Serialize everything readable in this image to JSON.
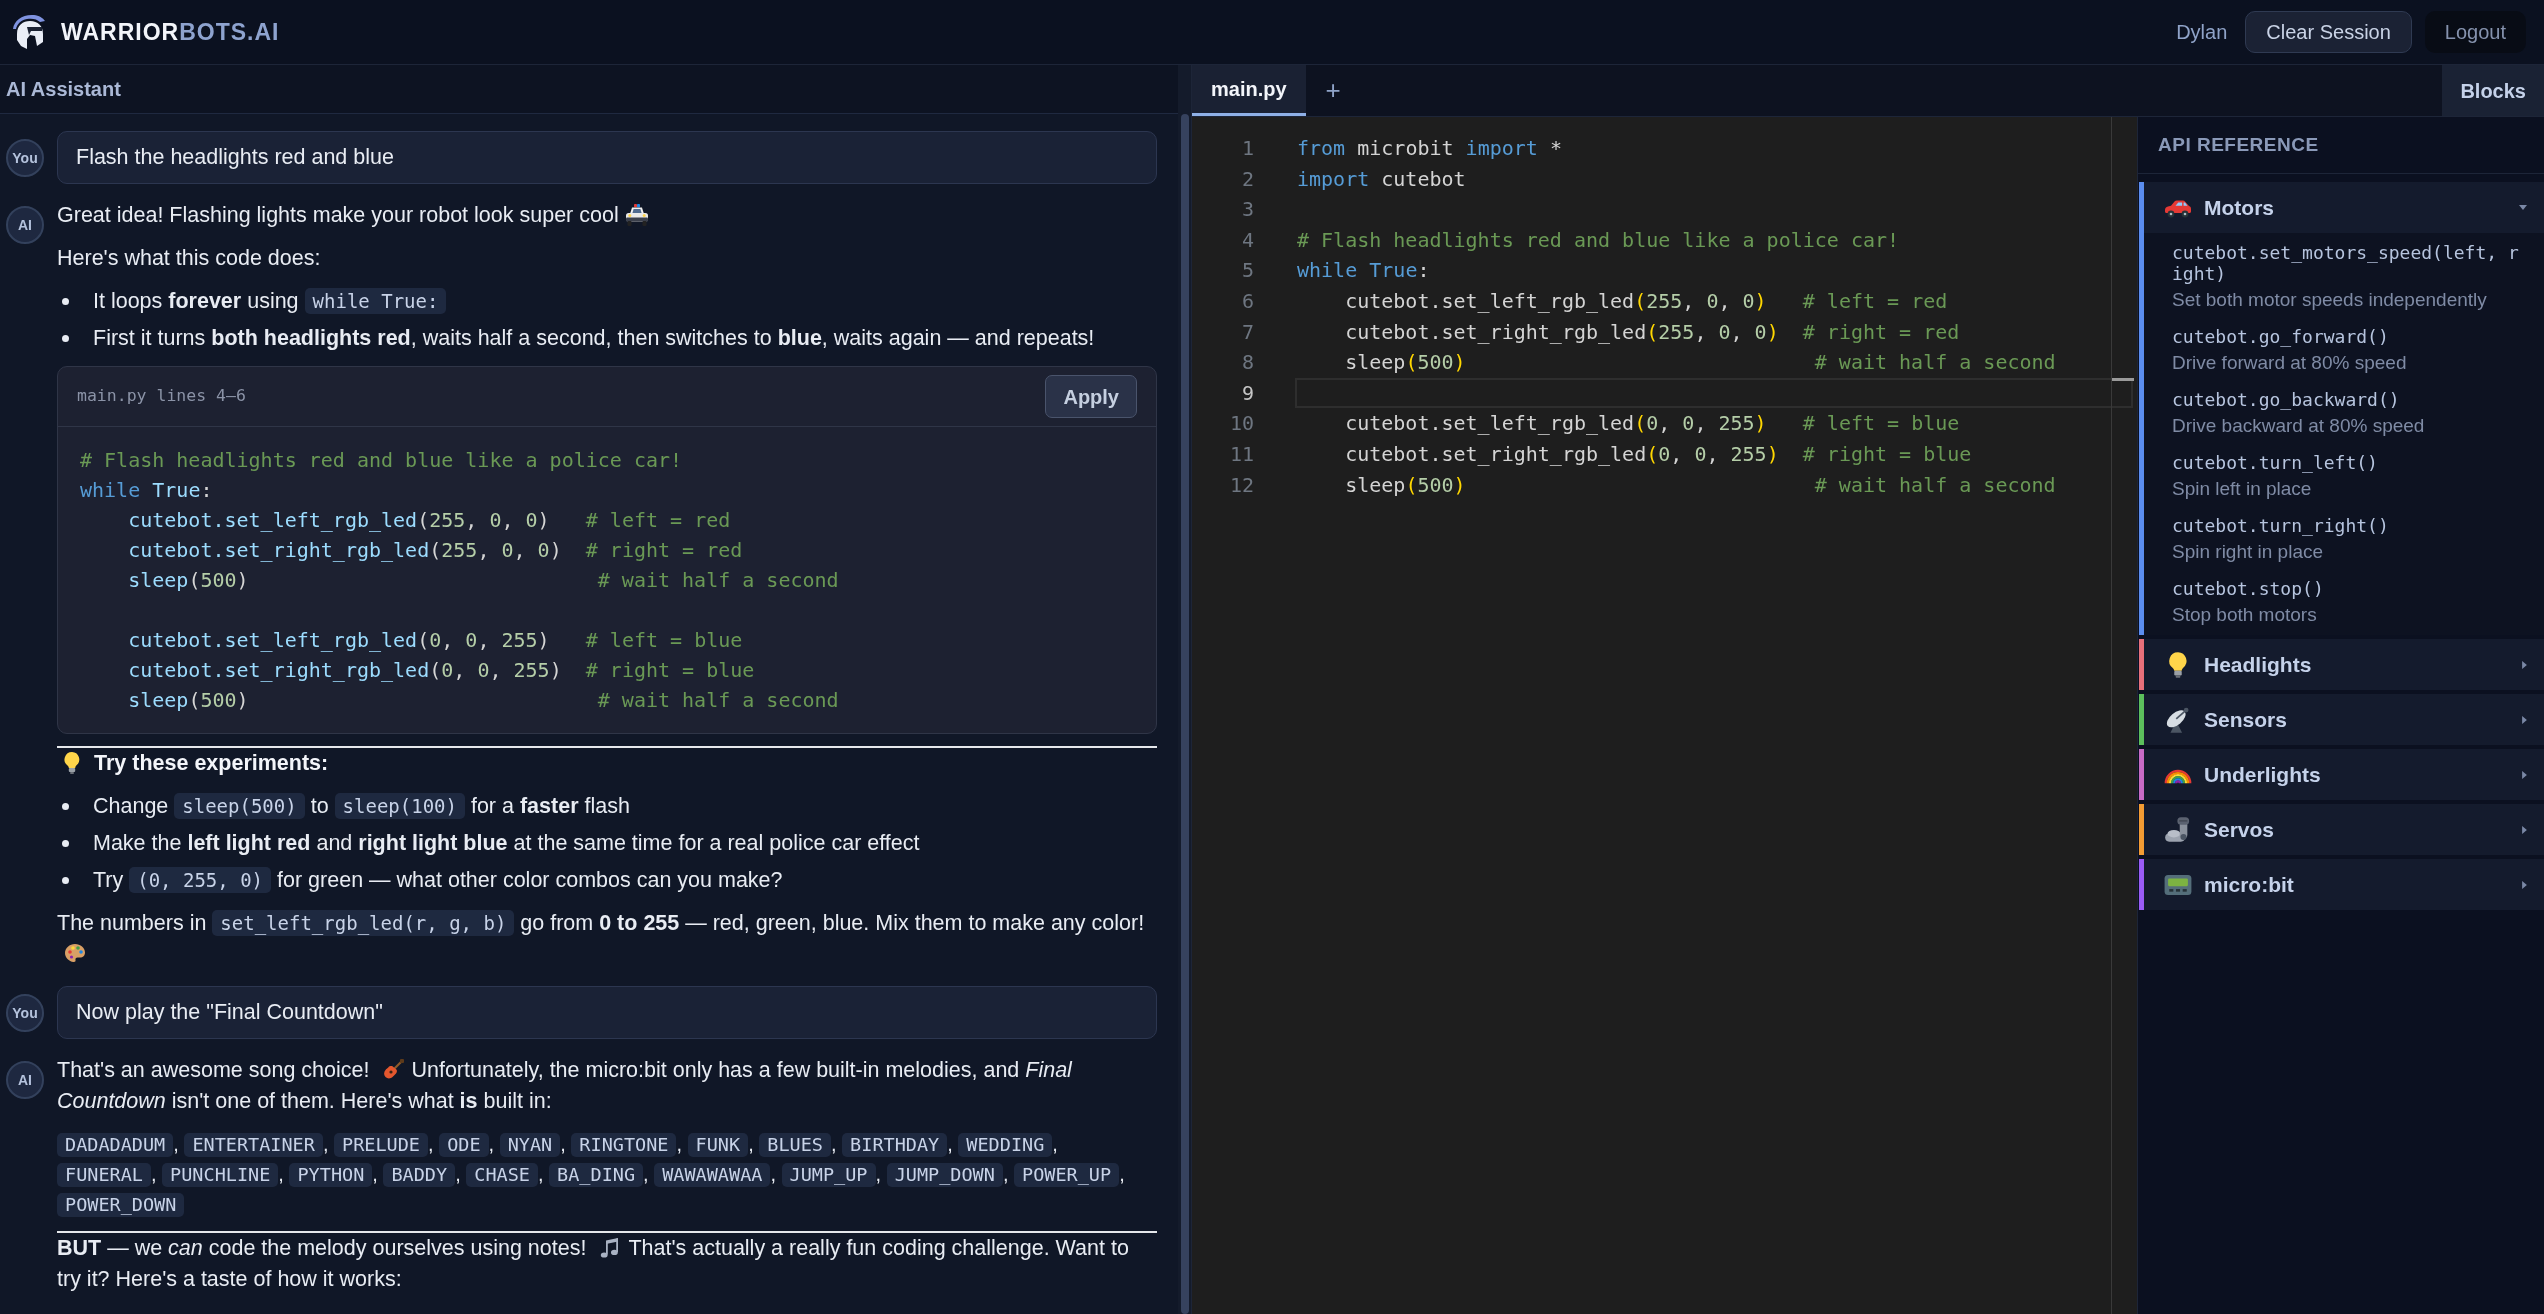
{
  "header": {
    "brand": {
      "primary": "WARRIOR",
      "secondary": "BOTS.AI"
    },
    "user": "Dylan",
    "buttons": [
      {
        "label": "Clear Session",
        "kind": "outlined"
      },
      {
        "label": "Logout",
        "kind": "plain"
      }
    ]
  },
  "chat": {
    "title": "AI Assistant",
    "messages": [
      {
        "kind": "user",
        "avatar": "You",
        "text": "Flash the headlights red and blue"
      },
      {
        "kind": "assistant",
        "avatar": "AI",
        "blocks": [
          {
            "kind": "paragraph",
            "segments": [
              {
                "kind": "text",
                "text": "Great idea! Flashing lights make your robot look super cool"
              },
              {
                "kind": "emoji"
              }
            ]
          },
          {
            "kind": "paragraph",
            "segments": [
              {
                "kind": "text",
                "text": "Here's what this code does:"
              }
            ]
          },
          {
            "kind": "bullets",
            "items": [
              [
                {
                  "kind": "text",
                  "text": "It loops **forever** using "
                },
                {
                  "kind": "code",
                  "text": "while True:"
                }
              ],
              [
                {
                  "kind": "text",
                  "text": "First it turns **both headlights red**, waits half a second, then switches to **blue**, waits again — and repeats!"
                }
              ]
            ]
          },
          {
            "kind": "code",
            "title": "main.py lines 4–6",
            "button": "Apply",
            "lines": [
              {
                "kind": "code",
                "tokens": [
                  {
                    "kind": "comment",
                    "text": "# Flash headlights red and blue like a police car!"
                  }
                ]
              },
              {
                "kind": "code",
                "tokens": [
                  {
                    "kind": "keyword",
                    "text": "while"
                  },
                  {
                    "kind": "name",
                    "text": " True"
                  },
                  {
                    "kind": "plain",
                    "text": ":"
                  }
                ]
              },
              {
                "kind": "code",
                "tokens": [
                  {
                    "kind": "name",
                    "text": "    cutebot.set_left_rgb_led"
                  },
                  {
                    "kind": "plain",
                    "text": "("
                  },
                  {
                    "kind": "number",
                    "text": "255"
                  },
                  {
                    "kind": "plain",
                    "text": ", "
                  },
                  {
                    "kind": "number",
                    "text": "0"
                  },
                  {
                    "kind": "plain",
                    "text": ", "
                  },
                  {
                    "kind": "number",
                    "text": "0"
                  },
                  {
                    "kind": "plain",
                    "text": ")"
                  },
                  {
                    "kind": "comment",
                    "text": "   # left = red"
                  }
                ]
              },
              {
                "kind": "code",
                "tokens": [
                  {
                    "kind": "name",
                    "text": "    cutebot.set_right_rgb_led"
                  },
                  {
                    "kind": "plain",
                    "text": "("
                  },
                  {
                    "kind": "number",
                    "text": "255"
                  },
                  {
                    "kind": "plain",
                    "text": ", "
                  },
                  {
                    "kind": "number",
                    "text": "0"
                  },
                  {
                    "kind": "plain",
                    "text": ", "
                  },
                  {
                    "kind": "number",
                    "text": "0"
                  },
                  {
                    "kind": "plain",
                    "text": ")"
                  },
                  {
                    "kind": "comment",
                    "text": "  # right = red"
                  }
                ]
              },
              {
                "kind": "code",
                "tokens": [
                  {
                    "kind": "name",
                    "text": "    sleep"
                  },
                  {
                    "kind": "plain",
                    "text": "("
                  },
                  {
                    "kind": "number",
                    "text": "500"
                  },
                  {
                    "kind": "plain",
                    "text": ")"
                  },
                  {
                    "kind": "comment",
                    "text": "                             # wait half a second"
                  }
                ]
              },
              {
                "kind": "blank"
              },
              {
                "kind": "code",
                "tokens": [
                  {
                    "kind": "name",
                    "text": "    cutebot.set_left_rgb_led"
                  },
                  {
                    "kind": "plain",
                    "text": "("
                  },
                  {
                    "kind": "number",
                    "text": "0"
                  },
                  {
                    "kind": "plain",
                    "text": ", "
                  },
                  {
                    "kind": "number",
                    "text": "0"
                  },
                  {
                    "kind": "plain",
                    "text": ", "
                  },
                  {
                    "kind": "number",
                    "text": "255"
                  },
                  {
                    "kind": "plain",
                    "text": ")"
                  },
                  {
                    "kind": "comment",
                    "text": "   # left = blue"
                  }
                ]
              },
              {
                "kind": "code",
                "tokens": [
                  {
                    "kind": "name",
                    "text": "    cutebot.set_right_rgb_led"
                  },
                  {
                    "kind": "plain",
                    "text": "("
                  },
                  {
                    "kind": "number",
                    "text": "0"
                  },
                  {
                    "kind": "plain",
                    "text": ", "
                  },
                  {
                    "kind": "number",
                    "text": "0"
                  },
                  {
                    "kind": "plain",
                    "text": ", "
                  },
                  {
                    "kind": "number",
                    "text": "255"
                  },
                  {
                    "kind": "plain",
                    "text": ")"
                  },
                  {
                    "kind": "comment",
                    "text": "  # right = blue"
                  }
                ]
              },
              {
                "kind": "code",
                "tokens": [
                  {
                    "kind": "name",
                    "text": "    sleep"
                  },
                  {
                    "kind": "plain",
                    "text": "("
                  },
                  {
                    "kind": "number",
                    "text": "500"
                  },
                  {
                    "kind": "plain",
                    "text": ")"
                  },
                  {
                    "kind": "comment",
                    "text": "                             # wait half a second"
                  }
                ]
              }
            ]
          },
          {
            "kind": "rule"
          },
          {
            "kind": "heading",
            "segments": [
              {
                "kind": "emoji"
              },
              {
                "kind": "text",
                "text": "Try these experiments:"
              }
            ]
          },
          {
            "kind": "bullets",
            "items": [
              [
                {
                  "kind": "text",
                  "text": "Change "
                },
                {
                  "kind": "code",
                  "text": "sleep(500)"
                },
                {
                  "kind": "text",
                  "text": " to "
                },
                {
                  "kind": "code",
                  "text": "sleep(100)"
                },
                {
                  "kind": "text",
                  "text": " for a **faster** flash"
                }
              ],
              [
                {
                  "kind": "text",
                  "text": "Make the **left light red** and **right light blue** at the same time for a real police car effect"
                }
              ],
              [
                {
                  "kind": "text",
                  "text": "Try "
                },
                {
                  "kind": "code",
                  "text": "(0, 255, 0)"
                },
                {
                  "kind": "text",
                  "text": " for green — what other color combos can you make?"
                }
              ]
            ]
          },
          {
            "kind": "paragraph",
            "segments": [
              {
                "kind": "text",
                "text": "The numbers in "
              },
              {
                "kind": "code",
                "text": "set_left_rgb_led(r, g, b)"
              },
              {
                "kind": "text",
                "text": " go from **0 to 255** — red, green, blue. Mix them to make any color!"
              },
              {
                "kind": "emoji"
              }
            ]
          }
        ]
      },
      {
        "kind": "user",
        "avatar": "You",
        "text": "Now play the \"Final Countdown\""
      },
      {
        "kind": "assistant",
        "avatar": "AI",
        "blocks": [
          {
            "kind": "paragraph",
            "segments": [
              {
                "kind": "text",
                "text": "That's an awesome song choice! "
              },
              {
                "kind": "emoji"
              },
              {
                "kind": "text",
                "text": "Unfortunately, the micro:bit only has a few built-in melodies, and *Final Countdown* isn't one of them. Here's what **is** built in:"
              }
            ]
          },
          {
            "kind": "chips",
            "separator": ", ",
            "items": [
              "DADADADUM",
              "ENTERTAINER",
              "PRELUDE",
              "ODE",
              "NYAN",
              "RINGTONE",
              "FUNK",
              "BLUES",
              "BIRTHDAY",
              "WEDDING",
              "FUNERAL",
              "PUNCHLINE",
              "PYTHON",
              "BADDY",
              "CHASE",
              "BA_DING",
              "WAWAWAWAA",
              "JUMP_UP",
              "JUMP_DOWN",
              "POWER_UP",
              "POWER_DOWN"
            ]
          },
          {
            "kind": "rule"
          },
          {
            "kind": "paragraph",
            "segments": [
              {
                "kind": "text",
                "text": "**BUT** — we *can* code the melody ourselves using notes! "
              },
              {
                "kind": "emoji"
              },
              {
                "kind": "text",
                "text": "That's actually a really fun coding challenge. Want to try it? Here's a taste of how it works:"
              }
            ]
          }
        ]
      }
    ]
  },
  "editor": {
    "tabs": [
      {
        "label": "main.py",
        "selected": true
      }
    ],
    "add_tab": "+",
    "view_button": "Blocks",
    "lines": [
      {
        "number": "1",
        "active": false,
        "tokens": [
          {
            "kind": "keyword",
            "text": "from"
          },
          {
            "kind": "plain",
            "text": " microbit "
          },
          {
            "kind": "keyword",
            "text": "import"
          },
          {
            "kind": "plain",
            "text": " *"
          }
        ]
      },
      {
        "number": "2",
        "active": false,
        "tokens": [
          {
            "kind": "keyword",
            "text": "import"
          },
          {
            "kind": "plain",
            "text": " cutebot"
          }
        ]
      },
      {
        "number": "3",
        "active": false
      },
      {
        "number": "4",
        "active": false,
        "tokens": [
          {
            "kind": "comment",
            "text": "# Flash headlights red and blue like a police car!"
          }
        ]
      },
      {
        "number": "5",
        "active": false,
        "tokens": [
          {
            "kind": "keyword",
            "text": "while"
          },
          {
            "kind": "keyword",
            "text": " True"
          },
          {
            "kind": "plain",
            "text": ":"
          }
        ]
      },
      {
        "number": "6",
        "active": false,
        "tokens": [
          {
            "kind": "plain",
            "text": "    cutebot.set_left_rgb_led"
          },
          {
            "kind": "bracket",
            "text": "("
          },
          {
            "kind": "number",
            "text": "255"
          },
          {
            "kind": "plain",
            "text": ", "
          },
          {
            "kind": "number",
            "text": "0"
          },
          {
            "kind": "plain",
            "text": ", "
          },
          {
            "kind": "number",
            "text": "0"
          },
          {
            "kind": "bracket",
            "text": ")"
          },
          {
            "kind": "comment",
            "text": "   # left = red"
          }
        ]
      },
      {
        "number": "7",
        "active": false,
        "tokens": [
          {
            "kind": "plain",
            "text": "    cutebot.set_right_rgb_led"
          },
          {
            "kind": "bracket",
            "text": "("
          },
          {
            "kind": "number",
            "text": "255"
          },
          {
            "kind": "plain",
            "text": ", "
          },
          {
            "kind": "number",
            "text": "0"
          },
          {
            "kind": "plain",
            "text": ", "
          },
          {
            "kind": "number",
            "text": "0"
          },
          {
            "kind": "bracket",
            "text": ")"
          },
          {
            "kind": "comment",
            "text": "  # right = red"
          }
        ]
      },
      {
        "number": "8",
        "active": false,
        "tokens": [
          {
            "kind": "plain",
            "text": "    sleep"
          },
          {
            "kind": "bracket",
            "text": "("
          },
          {
            "kind": "number",
            "text": "500"
          },
          {
            "kind": "bracket",
            "text": ")"
          },
          {
            "kind": "comment",
            "text": "                             # wait half a second"
          }
        ]
      },
      {
        "number": "9",
        "active": true
      },
      {
        "number": "10",
        "active": false,
        "tokens": [
          {
            "kind": "plain",
            "text": "    cutebot.set_left_rgb_led"
          },
          {
            "kind": "bracket",
            "text": "("
          },
          {
            "kind": "number",
            "text": "0"
          },
          {
            "kind": "plain",
            "text": ", "
          },
          {
            "kind": "number",
            "text": "0"
          },
          {
            "kind": "plain",
            "text": ", "
          },
          {
            "kind": "number",
            "text": "255"
          },
          {
            "kind": "bracket",
            "text": ")"
          },
          {
            "kind": "comment",
            "text": "   # left = blue"
          }
        ]
      },
      {
        "number": "11",
        "active": false,
        "tokens": [
          {
            "kind": "plain",
            "text": "    cutebot.set_right_rgb_led"
          },
          {
            "kind": "bracket",
            "text": "("
          },
          {
            "kind": "number",
            "text": "0"
          },
          {
            "kind": "plain",
            "text": ", "
          },
          {
            "kind": "number",
            "text": "0"
          },
          {
            "kind": "plain",
            "text": ", "
          },
          {
            "kind": "number",
            "text": "255"
          },
          {
            "kind": "bracket",
            "text": ")"
          },
          {
            "kind": "comment",
            "text": "  # right = blue"
          }
        ]
      },
      {
        "number": "12",
        "active": false,
        "tokens": [
          {
            "kind": "plain",
            "text": "    sleep"
          },
          {
            "kind": "bracket",
            "text": "("
          },
          {
            "kind": "number",
            "text": "500"
          },
          {
            "kind": "bracket",
            "text": ")"
          },
          {
            "kind": "comment",
            "text": "                             # wait half a second"
          }
        ]
      }
    ]
  },
  "api_reference": {
    "title": "API REFERENCE",
    "sections": [
      {
        "name": "Motors",
        "color": "#5b8def",
        "expanded": true,
        "items": [
          {
            "signature": "cutebot.set_motors_speed(left, right)",
            "description": "Set both motor speeds independently"
          },
          {
            "signature": "cutebot.go_forward()",
            "description": "Drive forward at 80% speed"
          },
          {
            "signature": "cutebot.go_backward()",
            "description": "Drive backward at 80% speed"
          },
          {
            "signature": "cutebot.turn_left()",
            "description": "Spin left in place"
          },
          {
            "signature": "cutebot.turn_right()",
            "description": "Spin right in place"
          },
          {
            "signature": "cutebot.stop()",
            "description": "Stop both motors"
          }
        ]
      },
      {
        "name": "Headlights",
        "color": "#e8707a",
        "expanded": false
      },
      {
        "name": "Sensors",
        "color": "#5cbf5c",
        "expanded": false
      },
      {
        "name": "Underlights",
        "color": "#c86bc6",
        "expanded": false
      },
      {
        "name": "Servos",
        "color": "#f39c33",
        "expanded": false
      },
      {
        "name": "micro:bit",
        "color": "#9b5cf6",
        "expanded": false
      }
    ]
  }
}
